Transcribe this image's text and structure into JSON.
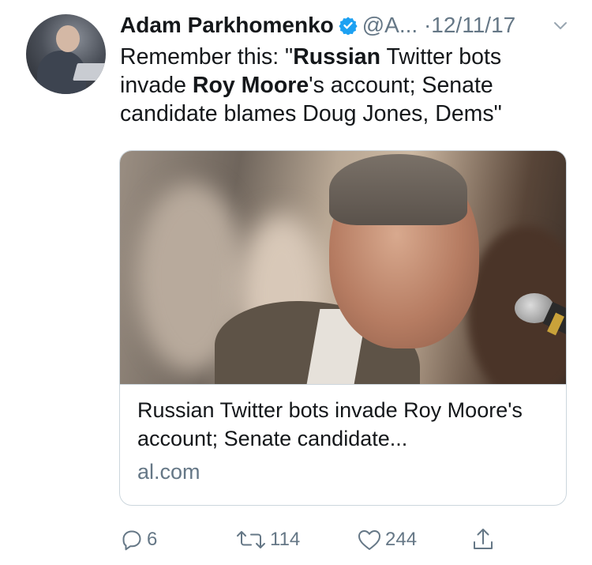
{
  "tweet": {
    "display_name": "Adam Parkhomenko",
    "verified": true,
    "handle": "@A...",
    "separator": "·",
    "date": "12/11/17",
    "text": {
      "part1": "Remember this: \"",
      "bold1": "Russian",
      "part2": " Twitter bots invade ",
      "bold2": "Roy Moore",
      "part3": "'s account; Senate candidate blames Doug Jones, Dems\""
    }
  },
  "card": {
    "title": "Russian Twitter bots invade Roy Moore's account; Senate candidate...",
    "domain": "al.com"
  },
  "actions": {
    "reply_count": "6",
    "retweet_count": "114",
    "like_count": "244"
  },
  "icons": {
    "verified": "verified-badge-icon",
    "chevron": "chevron-down-icon",
    "reply": "reply-icon",
    "retweet": "retweet-icon",
    "like": "heart-icon",
    "share": "share-icon"
  },
  "colors": {
    "primary_text": "#14171a",
    "secondary_text": "#657786",
    "verified_blue": "#1da1f2",
    "border": "#ccd6dd"
  }
}
